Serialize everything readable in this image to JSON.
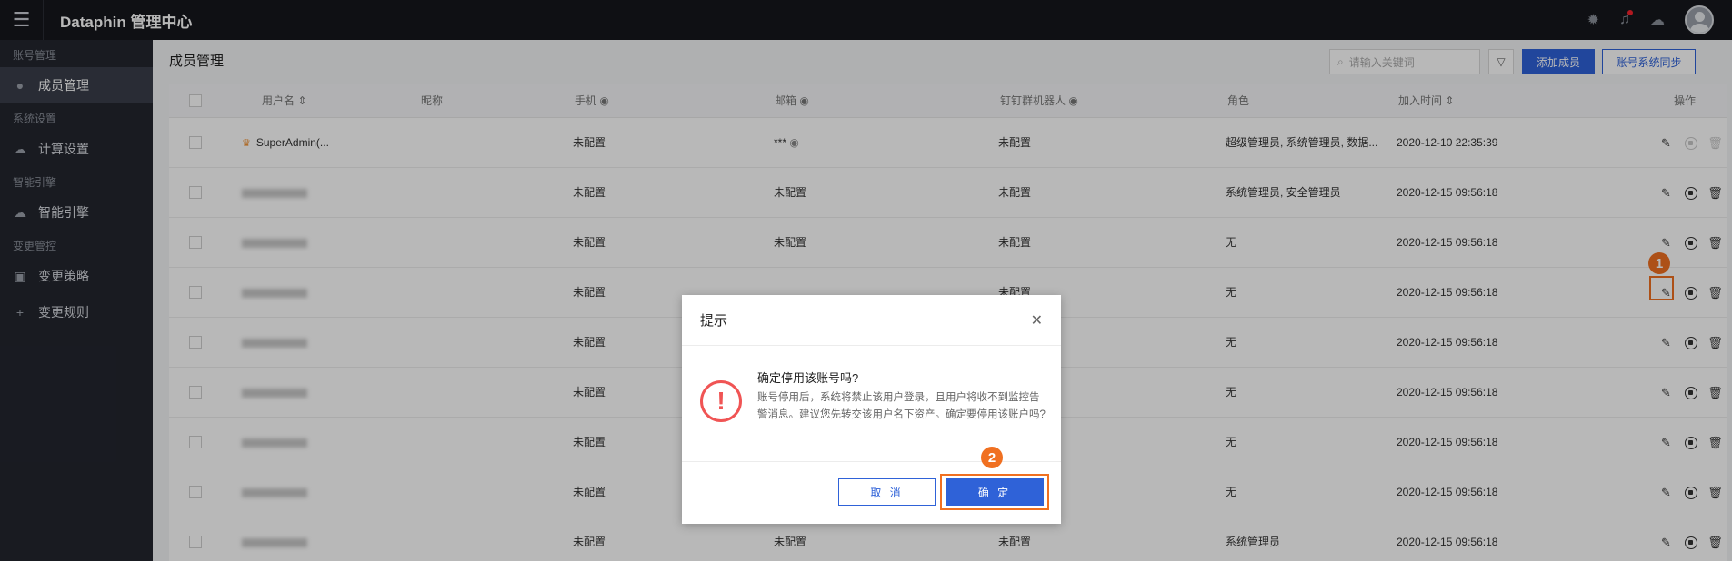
{
  "app": {
    "title": "Dataphin 管理中心"
  },
  "sidebar": {
    "groups": [
      {
        "label": "账号管理",
        "items": [
          {
            "label": "成员管理",
            "icon": "user-icon"
          }
        ]
      },
      {
        "label": "系统设置",
        "items": [
          {
            "label": "计算设置",
            "icon": "cloud-icon"
          }
        ]
      },
      {
        "label": "智能引擎",
        "items": [
          {
            "label": "智能引擎",
            "icon": "cloud-icon"
          }
        ]
      },
      {
        "label": "变更管控",
        "items": [
          {
            "label": "变更策略",
            "icon": "camera-icon"
          },
          {
            "label": "变更规则",
            "icon": "plus-icon"
          }
        ]
      }
    ]
  },
  "page": {
    "title": "成员管理"
  },
  "toolbar": {
    "search_placeholder": "请输入关键词",
    "add_member": "添加成员",
    "sync_accounts": "账号系统同步"
  },
  "table": {
    "columns": [
      "用户名",
      "昵称",
      "手机",
      "邮箱",
      "钉钉群机器人",
      "角色",
      "加入时间",
      "操作"
    ],
    "rows": [
      {
        "username": "SuperAdmin(...",
        "phone": "未配置",
        "email": "***",
        "dingtalk": "未配置",
        "role": "超级管理员, 系统管理员, 数据...",
        "joined": "2020-12-10 22:35:39",
        "admin": true
      },
      {
        "username": "",
        "phone": "未配置",
        "email": "未配置",
        "dingtalk": "未配置",
        "role": "系统管理员, 安全管理员",
        "joined": "2020-12-15 09:56:18"
      },
      {
        "username": "",
        "phone": "未配置",
        "email": "未配置",
        "dingtalk": "未配置",
        "role": "无",
        "joined": "2020-12-15 09:56:18"
      },
      {
        "username": "",
        "phone": "未配置",
        "email": "",
        "dingtalk": "未配置",
        "role": "无",
        "joined": "2020-12-15 09:56:18"
      },
      {
        "username": "",
        "phone": "未配置",
        "email": "",
        "dingtalk": "",
        "role": "无",
        "joined": "2020-12-15 09:56:18"
      },
      {
        "username": "",
        "phone": "未配置",
        "email": "",
        "dingtalk": "",
        "role": "无",
        "joined": "2020-12-15 09:56:18"
      },
      {
        "username": "",
        "phone": "未配置",
        "email": "",
        "dingtalk": "",
        "role": "无",
        "joined": "2020-12-15 09:56:18"
      },
      {
        "username": "",
        "phone": "未配置",
        "email": "",
        "dingtalk": "",
        "role": "无",
        "joined": "2020-12-15 09:56:18"
      },
      {
        "username": "",
        "phone": "未配置",
        "email": "未配置",
        "dingtalk": "未配置",
        "role": "系统管理员",
        "joined": "2020-12-15 09:56:18"
      }
    ]
  },
  "dialog": {
    "title": "提示",
    "question": "确定停用该账号吗?",
    "message": "账号停用后，系统将禁止该用户登录，且用户将收不到监控告警消息。建议您先转交该用户名下资产。确定要停用该账户吗?",
    "cancel": "取 消",
    "confirm": "确 定"
  },
  "steps": {
    "one": "1",
    "two": "2"
  },
  "colors": {
    "primary": "#2f62d8",
    "highlight": "#f07021",
    "danger": "#f05454",
    "sidebar_bg": "#23262f",
    "topbar_bg": "#15171c"
  }
}
